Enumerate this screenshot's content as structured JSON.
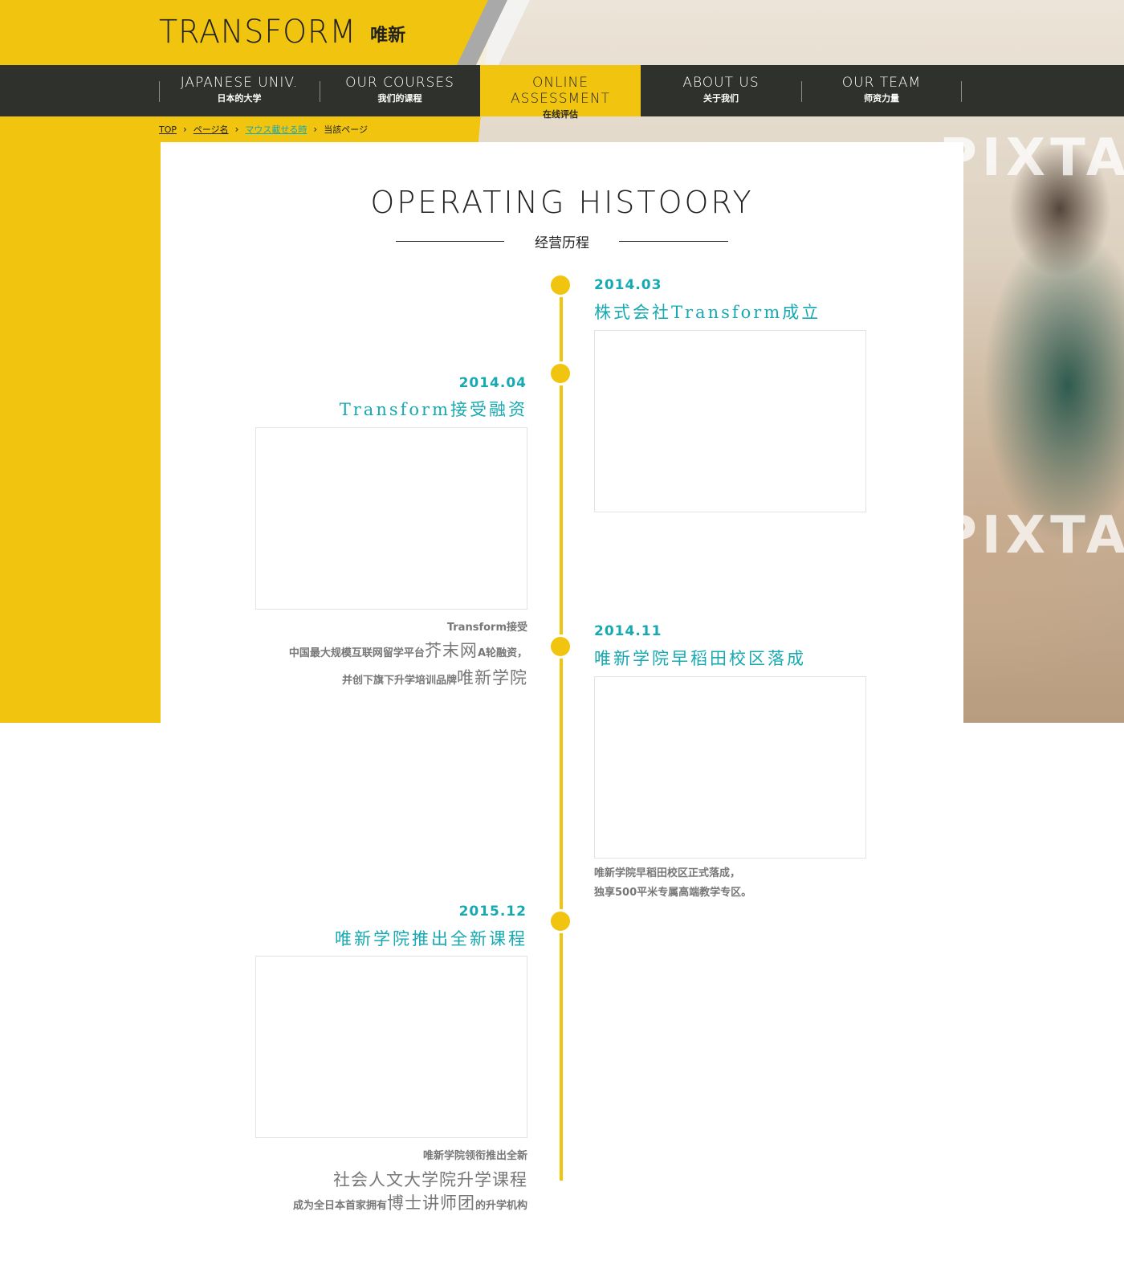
{
  "logo": {
    "en": "TRANSFORM",
    "cn": "唯新"
  },
  "hero": {
    "watermark": "PIXTA"
  },
  "nav": {
    "items": [
      {
        "en": "JAPANESE UNIV.",
        "cn": "日本的大学"
      },
      {
        "en": "OUR COURSES",
        "cn": "我们的课程"
      },
      {
        "en": "ONLINE ASSESSMENT",
        "cn": "在线评估"
      },
      {
        "en": "ABOUT US",
        "cn": "关于我们"
      },
      {
        "en": "OUR TEAM",
        "cn": "师资力量"
      }
    ],
    "active_index": 2
  },
  "breadcrumb": {
    "items": [
      "TOP",
      "ページ名",
      "マウス載せる時",
      "当該ページ"
    ]
  },
  "section": {
    "title_en": "OPERATING HISTOORY",
    "title_cn": "经营历程"
  },
  "timeline": [
    {
      "date": "2014.03",
      "title": "株式会社Transform成立"
    },
    {
      "date": "2014.04",
      "title": "Transform接受融资",
      "desc": {
        "l1": "Transform接受",
        "l2a": "中国最大规模互联网留学平台",
        "l2b": "芥末网",
        "l2c": "A轮融资，",
        "l3a": "并创下旗下升学培训品牌",
        "l3b": "唯新学院"
      }
    },
    {
      "date": "2014.11",
      "title": "唯新学院早稻田校区落成",
      "desc": {
        "l1": "唯新学院早稻田校区正式落成，",
        "l2": "独享500平米专属高端教学专区。"
      }
    },
    {
      "date": "2015.12",
      "title": "唯新学院推出全新课程",
      "desc": {
        "l1": "唯新学院领衔推出全新",
        "l2": "社会人文大学院升学课程",
        "l3a": "成为全日本首家拥有",
        "l3b": "博士讲师团",
        "l3c": "的升学机构"
      }
    }
  ],
  "colors": {
    "accent": "#f1c40f",
    "teal": "#17a9b1",
    "nav_bg": "#2f312c"
  }
}
